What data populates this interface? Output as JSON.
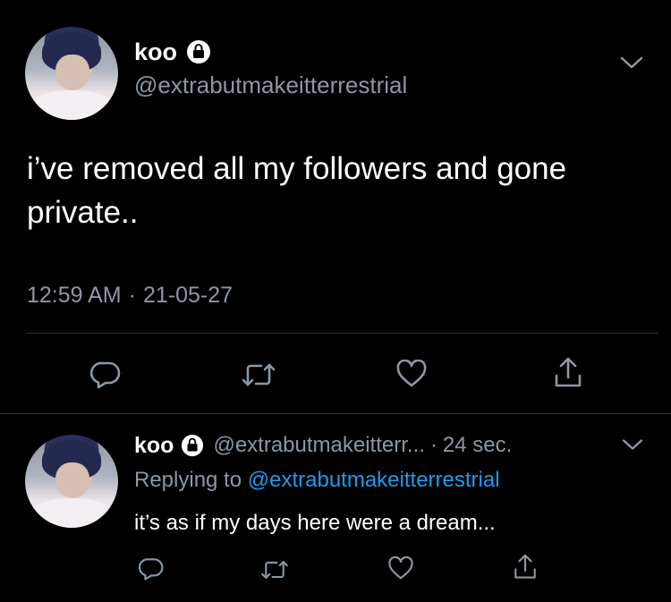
{
  "main_tweet": {
    "display_name": "koo",
    "handle": "@extrabutmakeitterrestrial",
    "text_line1": "i’ve removed all my followers and gone",
    "text_line2": "private..",
    "time": "12:59 AM",
    "dot": "·",
    "date": "21-05-27"
  },
  "reply_tweet": {
    "display_name": "koo",
    "handle_truncated": "@extrabutmakeitterr...",
    "dot": "·",
    "age": "24 sec.",
    "replying_to_label": "Replying to",
    "replying_to_handle": "@extrabutmakeitterrestrial",
    "text": "it’s as if my days here were a dream..."
  },
  "icons": {
    "verified_lock": "lock-icon",
    "menu": "chevron-down-icon",
    "reply": "reply-icon",
    "retweet": "retweet-icon",
    "like": "heart-icon",
    "share": "share-icon"
  },
  "colors": {
    "background": "#000000",
    "text": "#ffffff",
    "secondary": "#8b98a5",
    "accent": "#1d9bf0",
    "divider": "#2f3336"
  }
}
